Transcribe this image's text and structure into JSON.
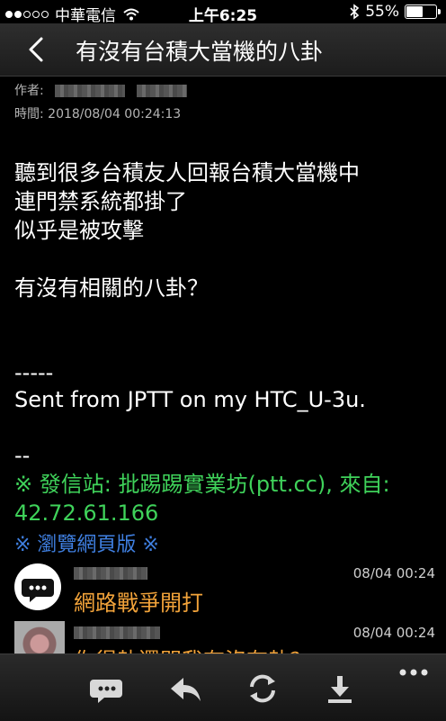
{
  "status_bar": {
    "carrier": "中華電信",
    "time": "上午6:25",
    "battery": "55%",
    "battery_level": 0.55,
    "signal_bars": 2
  },
  "nav": {
    "title": "有沒有台積大當機的八卦"
  },
  "article": {
    "author_label": "作者:",
    "time_label": "時間: 2018/08/04 00:24:13",
    "body_lines": [
      "聽到很多台積友人回報台積大當機中",
      "連門禁系統都掛了",
      "似乎是被攻擊",
      "有沒有相關的八卦？"
    ],
    "separator": "-----",
    "signature": "Sent from JPTT on my HTC_U-3u.",
    "sig_dash": "--",
    "source_line_1": "※ 發信站: 批踢踢實業坊(ptt.cc), 來自:",
    "source_line_2": "42.72.61.166",
    "web_link": "※ 瀏覽網頁版 ※"
  },
  "pushes": [
    {
      "time": "08/04 00:24",
      "text": "網路戰爭開打"
    },
    {
      "time": "08/04 00:24",
      "text": "你得執還問我有沒有執？"
    }
  ],
  "toolbar": {
    "icons": [
      "comment-icon",
      "reply-icon",
      "refresh-icon",
      "download-icon",
      "more-icon"
    ]
  },
  "colors": {
    "background": "#000000",
    "source_green": "#3fd25a",
    "link_blue": "#3f7fe0",
    "push_orange": "#f2a33a"
  }
}
